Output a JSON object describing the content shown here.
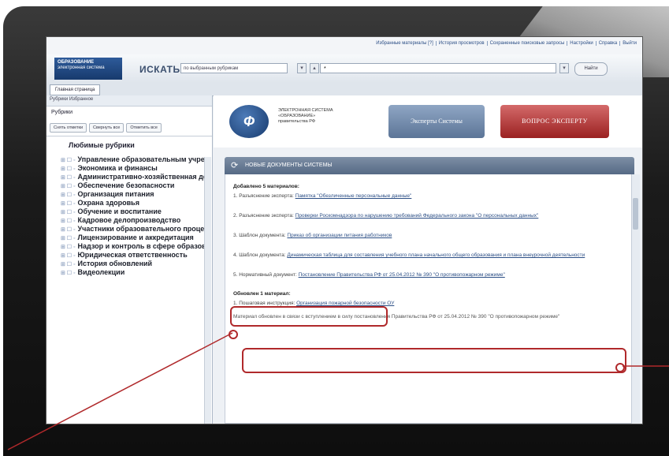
{
  "topbar": {
    "links": [
      "Избранные материалы [?]",
      "История просмотров",
      "Сохраненные поисковые запросы",
      "Настройки",
      "Справка",
      "Выйти"
    ]
  },
  "logo": {
    "title": "ОБРАЗОВАНИЕ",
    "subtitle": "электронная система"
  },
  "search": {
    "label": "ИСКАТЬ",
    "scope": "по выбранным рубрикам",
    "query": "*",
    "find_label": "Найти"
  },
  "tabs": {
    "main": "Главная страница"
  },
  "left": {
    "toolbar": "Рубрики   Избранное",
    "section_title": "Рубрики",
    "buttons": [
      "Снять отметки",
      "Свернуть все",
      "Отметить все"
    ],
    "favorites_title": "Любимые рубрики",
    "rubrics": [
      "Управление образовательным учреждением",
      "Экономика и финансы",
      "Административно-хозяйственная деятельность",
      "Обеспечение безопасности",
      "Организация питания",
      "Охрана здоровья",
      "Обучение и воспитание",
      "Кадровое делопроизводство",
      "Участники образовательного процесса",
      "Лицензирование и аккредитация",
      "Надзор и контроль в сфере образования",
      "Юридическая ответственность",
      "История обновлений",
      "Видеолекции"
    ]
  },
  "brand": {
    "text": "ЭЛЕКТРОННАЯ СИСТЕМА «ОБРАЗОВАНИЕ» правительства РФ"
  },
  "experts_button": "Эксперты Системы",
  "ask_button": "ВОПРОС ЭКСПЕРТУ",
  "news": {
    "title": "НОВЫЕ ДОКУМЕНТЫ СИСТЕМЫ",
    "added_head": "Добавлено 5 материалов:",
    "items": [
      {
        "prefix": "1. Разъяснение эксперта:",
        "link": "Памятка \"Обезличенные персональные данные\""
      },
      {
        "prefix": "2. Разъяснение эксперта:",
        "link": "Проверки Роскомнадзора по нарушению требований Федерального закона \"О персональных данных\""
      },
      {
        "prefix": "3. Шаблон документа:",
        "link": "Приказ об организации питания работников"
      },
      {
        "prefix": "4. Шаблон документа:",
        "link": "Динамическая таблица для составления учебного плана начального общего образования и плана внеурочной деятельности"
      },
      {
        "prefix": "5. Нормативный документ:",
        "link": "Постановление Правительства РФ от 25.04.2012 № 390 \"О противопожарном режиме\""
      }
    ],
    "updated_head": "Обновлен 1 материал:",
    "updated_item": {
      "prefix": "1. Пошаговая инструкция:",
      "link": "Организация пожарной безопасности ОУ"
    },
    "note": "Материал обновлен в связи с вступлением в силу постановления Правительства РФ от 25.04.2012 № 390 \"О противопожарном режиме\""
  }
}
